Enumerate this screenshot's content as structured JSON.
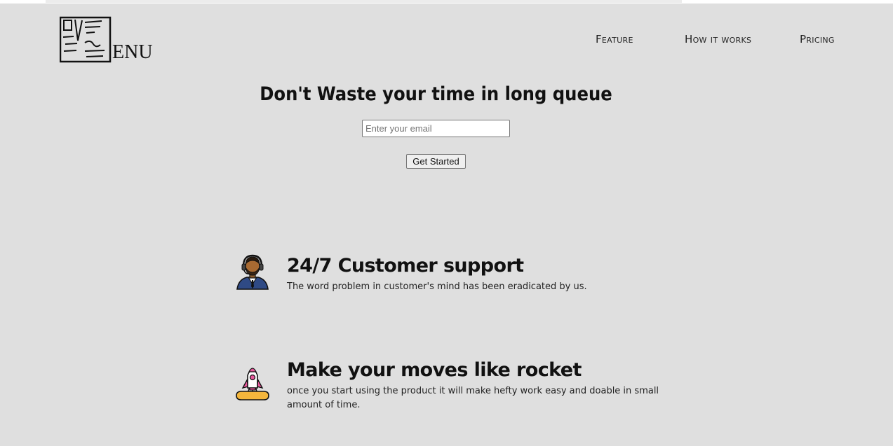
{
  "brand": {
    "logo_text": "ENU"
  },
  "nav": {
    "items": [
      {
        "label": "Feature"
      },
      {
        "label": "How it works"
      },
      {
        "label": "Pricing"
      }
    ]
  },
  "hero": {
    "title": "Don't Waste your time in long queue",
    "email_placeholder": "Enter your email",
    "cta_label": "Get Started"
  },
  "features": [
    {
      "icon": "customer-support-agent-icon",
      "title": "24/7 Customer support",
      "description": "The word problem in customer's mind has been eradicated by us."
    },
    {
      "icon": "rocket-icon",
      "title": "Make your moves like rocket",
      "description": "once you start using the product it will make hefty work easy and doable in small amount of time."
    }
  ],
  "colors": {
    "background": "#dfdfdf",
    "text": "#111111",
    "button_bg": "#efefef"
  }
}
